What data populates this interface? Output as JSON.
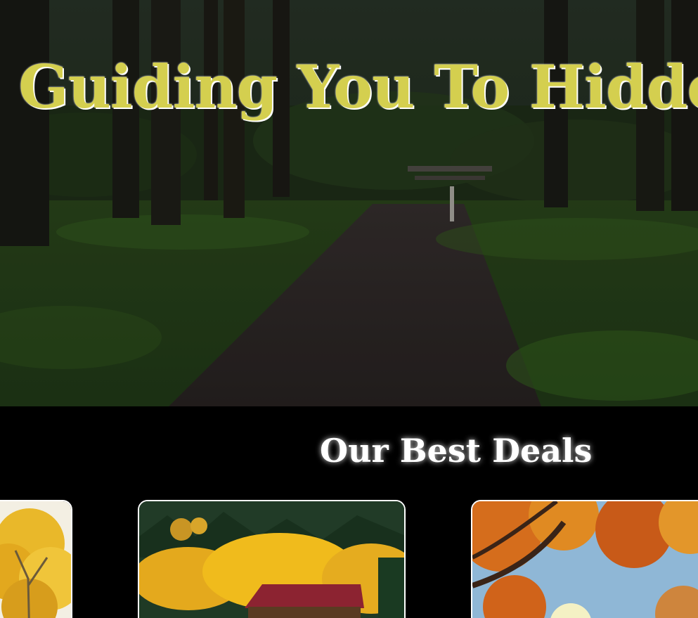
{
  "hero": {
    "title": "Guiding You To Hidden",
    "image": "forest-path-image"
  },
  "deals": {
    "title": "Our Best Deals",
    "cards": [
      {
        "image": "yellow-autumn-tree-image"
      },
      {
        "image": "cabin-autumn-forest-image"
      },
      {
        "image": "autumn-sunburst-tree-image"
      }
    ]
  },
  "colors": {
    "title_yellow": "#d4cf4f",
    "background": "#000000",
    "card_border": "#ffffff"
  }
}
